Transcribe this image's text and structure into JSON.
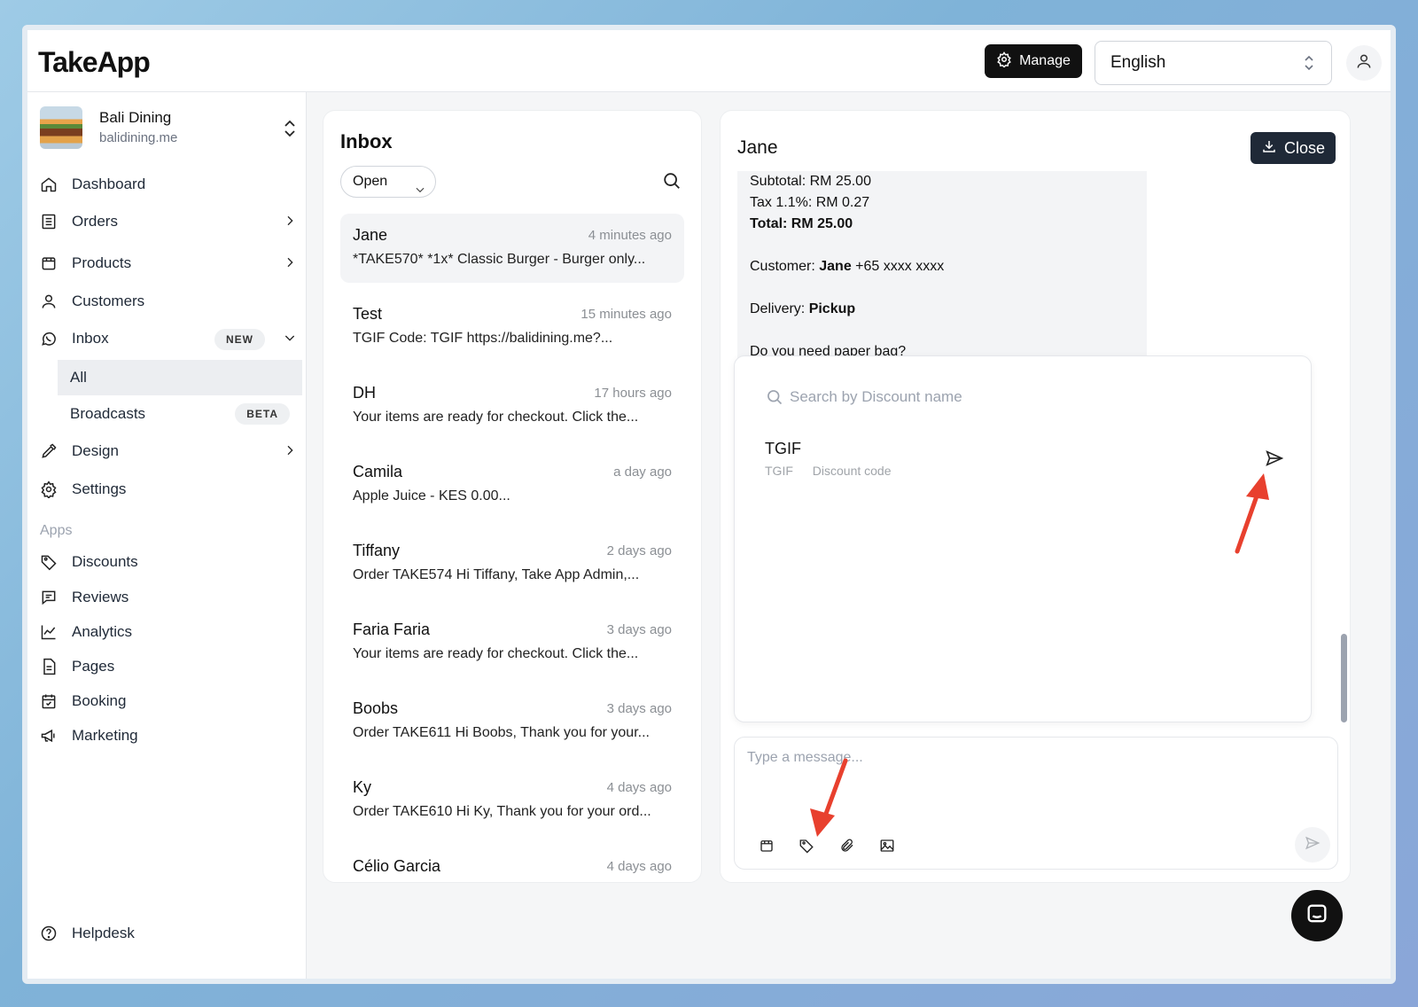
{
  "app": {
    "logo": "TakeApp"
  },
  "header": {
    "manage_label": "Manage",
    "language": "English"
  },
  "store": {
    "name": "Bali Dining",
    "url": "balidining.me"
  },
  "nav": {
    "dashboard": "Dashboard",
    "orders": "Orders",
    "products": "Products",
    "customers": "Customers",
    "inbox": "Inbox",
    "inbox_badge": "NEW",
    "inbox_all": "All",
    "broadcasts": "Broadcasts",
    "broadcasts_badge": "BETA",
    "design": "Design",
    "settings": "Settings",
    "apps_label": "Apps",
    "discounts": "Discounts",
    "reviews": "Reviews",
    "analytics": "Analytics",
    "pages": "Pages",
    "booking": "Booking",
    "marketing": "Marketing",
    "helpdesk": "Helpdesk"
  },
  "inbox": {
    "title": "Inbox",
    "filter": "Open",
    "conversations": [
      {
        "name": "Jane",
        "time": "4 minutes ago",
        "preview": "*TAKE570* *1x* Classic Burger - Burger only..."
      },
      {
        "name": "Test",
        "time": "15 minutes ago",
        "preview": "TGIF Code: TGIF https://balidining.me?..."
      },
      {
        "name": "DH",
        "time": "17 hours ago",
        "preview": "Your items are ready for checkout. Click the..."
      },
      {
        "name": "Camila",
        "time": "a day ago",
        "preview": "Apple Juice - KES 0.00..."
      },
      {
        "name": "Tiffany",
        "time": "2 days ago",
        "preview": "Order TAKE574 Hi Tiffany, Take App Admin,..."
      },
      {
        "name": "Faria Faria",
        "time": "3 days ago",
        "preview": "Your items are ready for checkout. Click the..."
      },
      {
        "name": "Boobs",
        "time": "3 days ago",
        "preview": "Order TAKE611 Hi Boobs, Thank you for your..."
      },
      {
        "name": "Ky",
        "time": "4 days ago",
        "preview": "Order TAKE610 Hi Ky, Thank you for your ord..."
      },
      {
        "name": "Célio Garcia",
        "time": "4 days ago",
        "preview": ""
      }
    ]
  },
  "chat": {
    "title": "Jane",
    "close_label": "Close",
    "message": {
      "subtotal": "Subtotal: RM 25.00",
      "tax": "Tax 1.1%: RM 0.27",
      "total": "Total: RM 25.00",
      "customer_label": "Customer: ",
      "customer_name": "Jane",
      "customer_phone": " +65 xxxx xxxx",
      "delivery_label": "Delivery: ",
      "delivery_value": "Pickup",
      "question": "Do you need paper bag?"
    },
    "discount_search_placeholder": "Search by Discount name",
    "discounts": [
      {
        "name": "TGIF",
        "code": "TGIF",
        "type": "Discount code"
      }
    ],
    "composer_placeholder": "Type a message..."
  },
  "icons": {
    "manage": "gear-icon",
    "send": "send-icon",
    "discount_tool": "tag-icon",
    "launcher": "chat-bubble-icon"
  },
  "colors": {
    "annotation_arrow": "#e8402e",
    "primary_dark": "#111111"
  }
}
